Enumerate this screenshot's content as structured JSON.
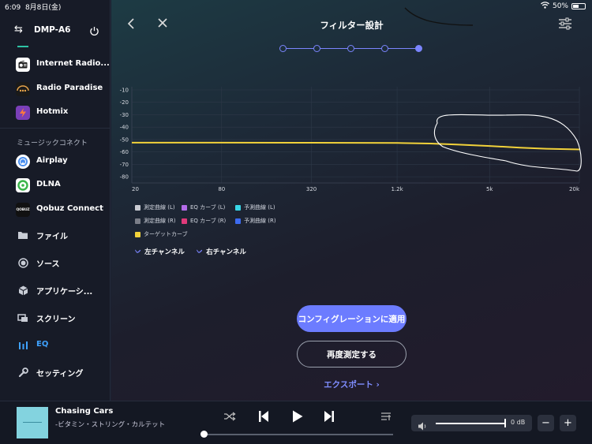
{
  "status": {
    "time": "6:09",
    "date": "8月8日(金)",
    "battery": "50%"
  },
  "sidebar": {
    "device": "DMP-A6",
    "section_label": "ミュージックコネクト",
    "items": [
      {
        "label": "Internet Radio...",
        "icon": "radio-icon"
      },
      {
        "label": "Radio Paradise",
        "icon": "radio-paradise-icon"
      },
      {
        "label": "Hotmix",
        "icon": "hotmix-icon"
      },
      {
        "label": "Airplay",
        "icon": "airplay-icon"
      },
      {
        "label": "DLNA",
        "icon": "dlna-icon"
      },
      {
        "label": "Qobuz Connect",
        "icon": "qobuz-icon",
        "icon_text": "QOBUZ"
      },
      {
        "label": "ファイル",
        "icon": "folder-icon"
      },
      {
        "label": "ソース",
        "icon": "source-icon"
      },
      {
        "label": "アプリケーシ...",
        "icon": "apps-icon"
      },
      {
        "label": "スクリーン",
        "icon": "screen-icon"
      },
      {
        "label": "EQ",
        "icon": "eq-icon",
        "active": true
      },
      {
        "label": "セッティング",
        "icon": "wrench-icon"
      }
    ]
  },
  "main": {
    "title": "フィルター設計",
    "steps_total": 5,
    "active_step": 5,
    "legend": [
      {
        "label": "測定曲線 (L)",
        "color": "#c9cbd2"
      },
      {
        "label": "EQ カーブ (L)",
        "color": "#b36be8"
      },
      {
        "label": "予測曲線 (L)",
        "color": "#38d6e6"
      },
      {
        "label": "測定曲線 (R)",
        "color": "#7a7e88"
      },
      {
        "label": "EQ カーブ (R)",
        "color": "#e03a7a"
      },
      {
        "label": "予測曲線 (R)",
        "color": "#3d6bf0"
      },
      {
        "label": "ターゲットカーブ",
        "color": "#f2d23a"
      }
    ],
    "channels": {
      "left": "左チャンネル",
      "right": "右チャンネル"
    },
    "apply_label": "コンフィグレーションに適用",
    "remeasure_label": "再度測定する",
    "export_label": "エクスポート ›"
  },
  "chart_data": {
    "type": "line",
    "x_ticks": [
      "20",
      "80",
      "320",
      "1.2k",
      "5k",
      "20k"
    ],
    "x_scale": "log",
    "xlim": [
      20,
      20000
    ],
    "y_ticks": [
      "-10",
      "-20",
      "-30",
      "-40",
      "-50",
      "-60",
      "-70",
      "-80"
    ],
    "ylim": [
      -85,
      -10
    ],
    "grid": true,
    "series": [
      {
        "name": "ターゲットカーブ",
        "color": "#f2d23a",
        "x": [
          20,
          80,
          320,
          1200,
          2000,
          3000,
          5000,
          8000,
          12000,
          20000
        ],
        "y": [
          -52.5,
          -52.5,
          -52.6,
          -52.8,
          -53.2,
          -54,
          -55.2,
          -56.5,
          -57.4,
          -58
        ]
      }
    ]
  },
  "player": {
    "title": "Chasing Cars",
    "artist": "-ビタミン・ストリング・カルテット",
    "volume": "0 dB",
    "progress": 0.0,
    "volume_level": 1.0
  }
}
